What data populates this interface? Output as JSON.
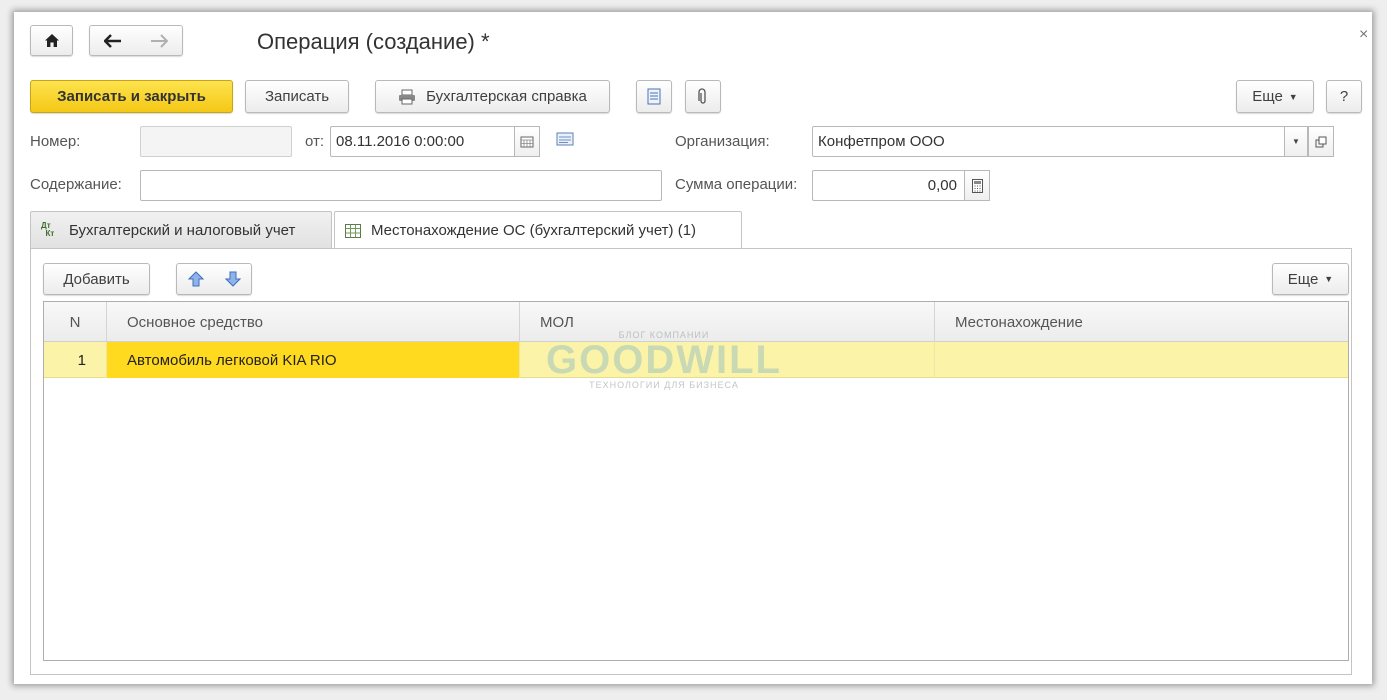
{
  "window": {
    "title": "Операция (создание) *",
    "close_glyph": "×"
  },
  "nav": {
    "home_icon": "home-icon",
    "back_icon": "arrow-left-icon",
    "forward_icon": "arrow-right-icon"
  },
  "toolbar": {
    "save_close_label": "Записать и закрыть",
    "save_label": "Записать",
    "report_label": "Бухгалтерская справка",
    "more_label": "Еще",
    "help_label": "?"
  },
  "form": {
    "number_label": "Номер:",
    "number_value": "",
    "date_label": "от:",
    "date_value": "08.11.2016  0:00:00",
    "org_label": "Организация:",
    "org_value": "Конфетпром ООО",
    "content_label": "Содержание:",
    "content_value": "",
    "sum_label": "Сумма операции:",
    "sum_value": "0,00"
  },
  "tabs": [
    {
      "label": "Бухгалтерский и налоговый учет",
      "icon_text": "ДтКт",
      "active": false
    },
    {
      "label": "Местонахождение ОС (бухгалтерский учет) (1)",
      "active": true
    }
  ],
  "table_toolbar": {
    "add_label": "Добавить",
    "more_label": "Еще"
  },
  "table": {
    "columns": [
      "N",
      "Основное средство",
      "МОЛ",
      "Местонахождение"
    ],
    "rows": [
      {
        "n": "1",
        "asset": "Автомобиль легковой KIA RIO",
        "mol": "",
        "location": ""
      }
    ]
  },
  "watermark": {
    "top": "БЛОГ КОМПАНИИ",
    "brand": "GOODWILL",
    "bottom": "ТЕХНОЛОГИИ ДЛЯ БИЗНЕСА"
  },
  "colors": {
    "primary_button": "#f4c816",
    "selected_cell": "#ffda1f",
    "row_highlight": "#fbf3a8"
  }
}
